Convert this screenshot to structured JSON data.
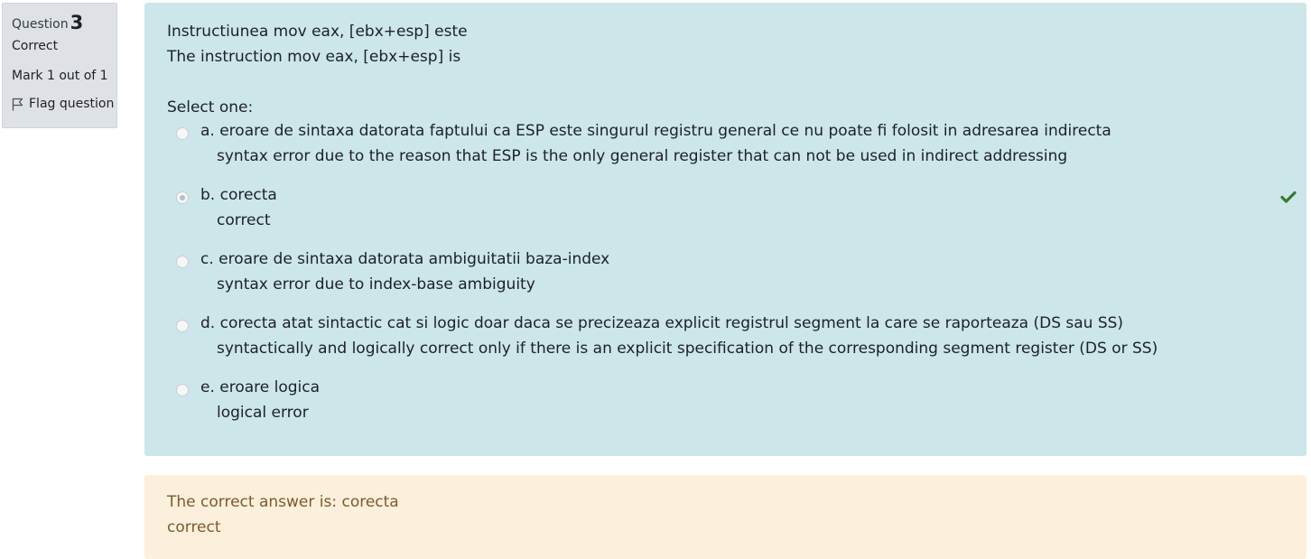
{
  "info": {
    "question_prefix": "Question",
    "question_number": "3",
    "state": "Correct",
    "grade": "Mark 1 out of 1",
    "flag_label": "Flag question"
  },
  "question": {
    "text_ro": "Instructiunea mov eax, [ebx+esp] este",
    "text_en": "The instruction mov eax, [ebx+esp] is",
    "prompt": "Select one:",
    "options": [
      {
        "line1": "a. eroare de sintaxa datorata faptului ca ESP este singurul registru general ce nu poate fi folosit in adresarea indirecta",
        "line2": "syntax error due to the reason that ESP is the only general register that can not be used in indirect addressing",
        "checked": false
      },
      {
        "line1": "b. corecta",
        "line2": "correct",
        "checked": true
      },
      {
        "line1": "c. eroare de sintaxa datorata ambiguitatii baza-index",
        "line2": "syntax error due to index-base ambiguity",
        "checked": false
      },
      {
        "line1": "d. corecta atat sintactic cat si logic doar daca se precizeaza explicit registrul segment la care se raporteaza (DS sau SS)",
        "line2": "syntactically and logically correct only if there is an explicit specification of the corresponding segment register (DS or SS)",
        "checked": false
      },
      {
        "line1": "e. eroare logica",
        "line2": "logical error",
        "checked": false
      }
    ]
  },
  "feedback": {
    "line1": "The correct answer is: corecta",
    "line2": "correct"
  },
  "colors": {
    "formulation_bg": "#cce6ea",
    "feedback_bg": "#fcefdc",
    "feedback_text": "#7d5a29",
    "info_bg": "#dee2e6",
    "correct_tick": "#357a32"
  },
  "icons": {
    "flag": "flag-icon",
    "correct": "check-icon"
  }
}
